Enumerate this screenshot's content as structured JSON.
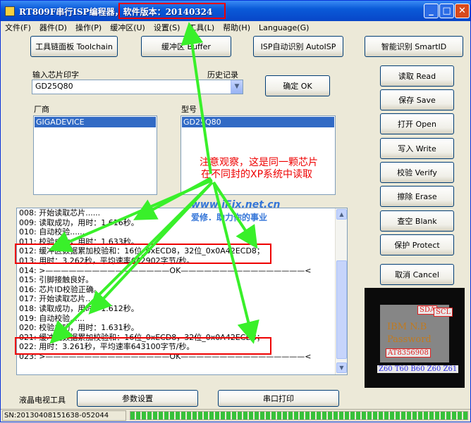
{
  "window": {
    "title": "RT809F串行ISP编程器，软件版本：20140324",
    "minimize_glyph": "_",
    "maximize_glyph": "□",
    "close_glyph": "✕"
  },
  "menu": [
    "文件(F)",
    "器件(D)",
    "操作(P)",
    "缓冲区(U)",
    "设置(S)",
    "工具(L)",
    "帮助(H)",
    "Language(G)"
  ],
  "toolbar": {
    "toolchain": "工具链面板 Toolchain",
    "buffer": "缓冲区 Buffer",
    "auto_isp": "ISP自动识别 AutoISP",
    "smart_id": "智能识别 SmartID"
  },
  "chip_input": {
    "label": "输入芯片印字",
    "value": "GD25Q80",
    "history_label": "历史记录",
    "ok": "确定 OK"
  },
  "vendor": {
    "label": "厂商",
    "selected": "GIGADEVICE"
  },
  "model": {
    "label": "型号",
    "selected": "GD25Q80"
  },
  "actions": {
    "read": "读取 Read",
    "save": "保存 Save",
    "open": "打开 Open",
    "write": "写入 Write",
    "verify": "校验 Verify",
    "erase": "擦除 Erase",
    "blank": "查空 Blank",
    "protect": "保护 Protect",
    "cancel": "取消 Cancel"
  },
  "annotation": {
    "line1": "注意观察，这是同一颗芯片",
    "line2": "在不同封的XP系统中读取"
  },
  "watermark": {
    "url": "www.iFix.net.cn",
    "slogan": "爱修．助力你的事业"
  },
  "log": [
    "008: 开始读取芯片......",
    "009: 读取成功，用时：1.616秒。",
    "010: 自动校验......",
    "011: 校验成功，用时：1.633秒。",
    "012: 缓冲区数据累加校验和：16位_0xECD8，32位_0x0A42ECD8；",
    "013: 用时：3.262秒，平均速率642902字节/秒。",
    "014: >————————————————OK————————————————<",
    "015: 引脚接触良好。",
    "016: 芯片ID校验正确。",
    "017: 开始读取芯片......",
    "018: 读取成功，用时：1.612秒。",
    "019: 自动校验......",
    "020: 校验成功，用时：1.631秒。",
    "021: 缓冲区数据累加校验和：16位_0xECD8，32位_0x0A42ECD8；",
    "022: 用时：3.261秒，平均速率643100字节/秒。",
    "023: >————————————————OK————————————————<"
  ],
  "chip_photo": {
    "brand": "IBM  N.B",
    "password": "Password",
    "part": "AT8356908",
    "sda": "SDA",
    "scl": "SCL",
    "pins": "Z60 T60 B60 Z60 Z61"
  },
  "bottom": {
    "lcd_tools": "液晶电视工具",
    "params": "参数设置",
    "serial_print": "串口打印"
  },
  "status": {
    "sn": "SN:20130408151638-052044",
    "progress_fraction": 1.0
  },
  "colors": {
    "annotation_red": "#ee0000",
    "arrow_green": "#39f02a",
    "title_blue": "#0a5ad8"
  }
}
